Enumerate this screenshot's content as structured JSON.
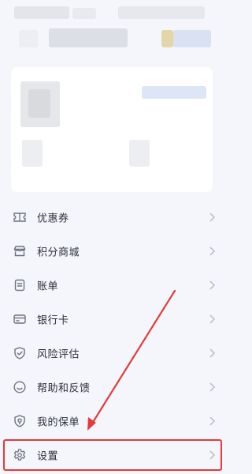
{
  "colors": {
    "background": "#f4f6fb",
    "card": "#ffffff",
    "annotation_red": "#e23b3b",
    "icon": "#6d7280",
    "chevron": "#b9bcc4"
  },
  "menu": {
    "items": [
      {
        "label": "优惠券",
        "icon": "ticket-icon"
      },
      {
        "label": "积分商城",
        "icon": "store-icon"
      },
      {
        "label": "账单",
        "icon": "bill-icon"
      },
      {
        "label": "银行卡",
        "icon": "bank-card-icon"
      },
      {
        "label": "风险评估",
        "icon": "shield-check-icon"
      },
      {
        "label": "帮助和反馈",
        "icon": "help-smile-icon"
      },
      {
        "label": "我的保单",
        "icon": "policy-shield-icon"
      },
      {
        "label": "设置",
        "icon": "gear-icon"
      }
    ]
  }
}
